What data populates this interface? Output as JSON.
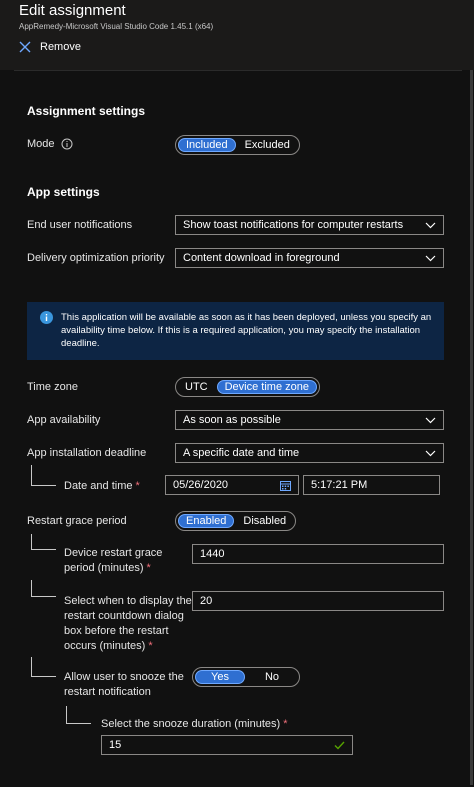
{
  "header": {
    "title": "Edit assignment",
    "subtitle": "AppRemedy-Microsoft Visual Studio Code 1.45.1 (x64)",
    "remove_label": "Remove"
  },
  "assignment_settings": {
    "heading": "Assignment settings",
    "mode": {
      "label": "Mode",
      "options": [
        "Included",
        "Excluded"
      ],
      "selected": "Included"
    }
  },
  "app_settings": {
    "heading": "App settings",
    "end_user_notifications": {
      "label": "End user notifications",
      "value": "Show toast notifications for computer restarts"
    },
    "delivery_priority": {
      "label": "Delivery optimization priority",
      "value": "Content download in foreground"
    },
    "info_text": "This application will be available as soon as it has been deployed, unless you specify an availability time below. If this is a required application, you may specify the installation deadline.",
    "time_zone": {
      "label": "Time zone",
      "options": [
        "UTC",
        "Device time zone"
      ],
      "selected": "Device time zone"
    },
    "app_availability": {
      "label": "App availability",
      "value": "As soon as possible"
    },
    "install_deadline": {
      "label": "App installation deadline",
      "value": "A specific date and time"
    },
    "date_time": {
      "label": "Date and time",
      "date": "05/26/2020",
      "time": "5:17:21 PM"
    },
    "restart_grace": {
      "label": "Restart grace period",
      "options": [
        "Enabled",
        "Disabled"
      ],
      "selected": "Enabled"
    },
    "device_restart_grace": {
      "label_line1": "Device restart grace",
      "label_line2": "period (minutes)",
      "value": "1440"
    },
    "countdown": {
      "label_line1": "Select when to display the",
      "label_line2": "restart countdown dialog",
      "label_line3": "box before the restart",
      "label_line4": "occurs (minutes)",
      "value": "20"
    },
    "snooze": {
      "label_line1": "Allow user to snooze the",
      "label_line2": "restart notification",
      "options": [
        "Yes",
        "No"
      ],
      "selected": "Yes"
    },
    "snooze_duration": {
      "label": "Select the snooze duration (minutes)",
      "value": "15"
    }
  },
  "required_marker": "*",
  "colors": {
    "accent": "#2f6fd1",
    "info_background": "#0d2544",
    "required": "#f1707b",
    "valid": "#57a300"
  }
}
